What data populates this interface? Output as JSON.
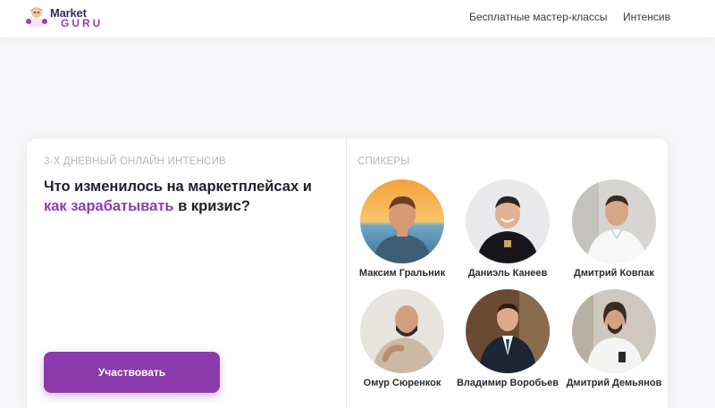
{
  "header": {
    "logo": {
      "word1": "Market",
      "word2": "GURU"
    },
    "nav": [
      {
        "label": "Бесплатные мастер-классы"
      },
      {
        "label": "Интенсив"
      }
    ]
  },
  "hero": {
    "eyebrow": "3-Х ДНЕВНЫЙ ОНЛАЙН ИНТЕНСИВ",
    "headline_part1": "Что изменилось на маркетплейсах и ",
    "headline_accent": "как зарабатывать",
    "headline_part2": " в кризис?",
    "cta_label": "Участвовать"
  },
  "speakers": {
    "title": "СПИКЕРЫ",
    "items": [
      {
        "name": "Максим Гральник"
      },
      {
        "name": "Даниэль Канеев"
      },
      {
        "name": "Дмитрий Ковпак"
      },
      {
        "name": "Омур Сюренкок"
      },
      {
        "name": "Владимир Воробьев"
      },
      {
        "name": "Дмитрий Демьянов"
      }
    ]
  },
  "colors": {
    "brand_purple": "#8a3aab",
    "accent_text": "#8d3bb5",
    "muted_text": "#b7b5be",
    "page_bg": "#f6f5f7"
  }
}
